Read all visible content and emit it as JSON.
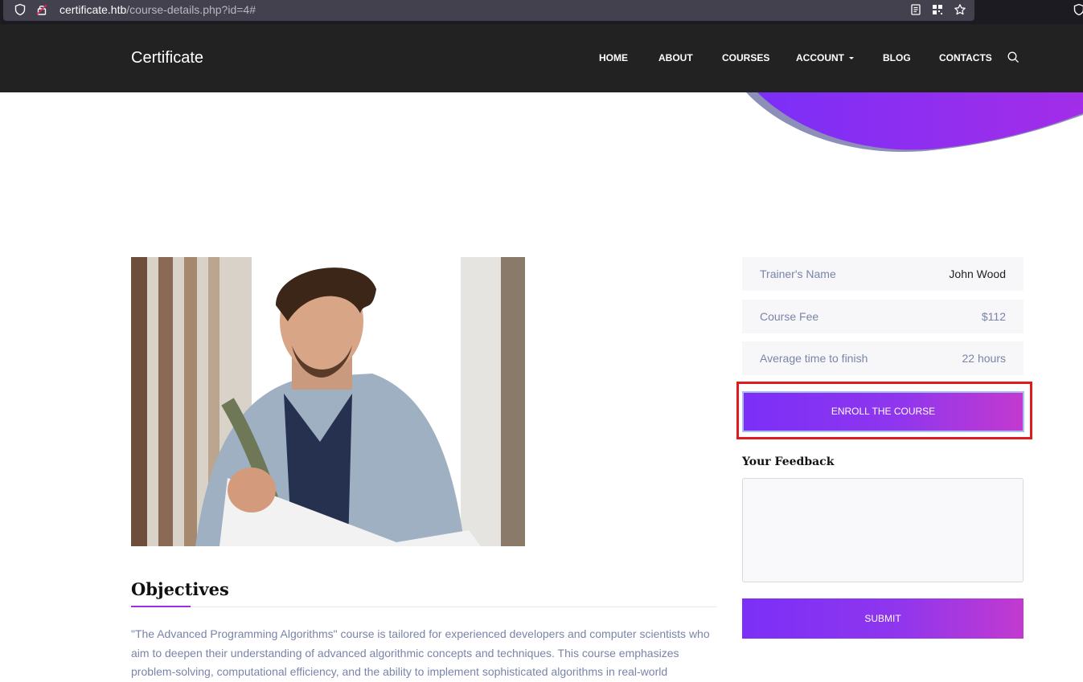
{
  "browser": {
    "url_host": "certificate.htb",
    "url_path": "/course-details.php?id=4#"
  },
  "header": {
    "brand": "Certificate",
    "nav": [
      {
        "label": "HOME"
      },
      {
        "label": "ABOUT"
      },
      {
        "label": "COURSES"
      },
      {
        "label": "ACCOUNT"
      },
      {
        "label": "BLOG"
      },
      {
        "label": "CONTACTS"
      }
    ]
  },
  "course": {
    "details": [
      {
        "label": "Trainer's Name",
        "value": "John Wood"
      },
      {
        "label": "Course Fee",
        "value": "$112"
      },
      {
        "label": "Average time to finish",
        "value": "22 hours"
      }
    ],
    "enroll_label": "ENROLL THE COURSE",
    "feedback_title": "Your Feedback",
    "feedback_value": "",
    "submit_label": "SUBMIT"
  },
  "objectives": {
    "title": "Objectives",
    "text": "\"The Advanced Programming Algorithms\" course is tailored for experienced developers and computer scientists who aim to deepen their understanding of advanced algorithmic concepts and techniques. This course emphasizes problem-solving, computational efficiency, and the ability to implement sophisticated algorithms in real-world"
  },
  "colors": {
    "header_bg": "#222222",
    "accent_start": "#7b2ff7",
    "accent_end": "#c23acf",
    "highlight": "#e01b1b"
  },
  "icons": {
    "shield": "shield-icon",
    "lock": "lock-icon",
    "reader": "reader-view-icon",
    "qr": "qr-code-icon",
    "star": "bookmark-star-icon",
    "search": "search-icon"
  }
}
